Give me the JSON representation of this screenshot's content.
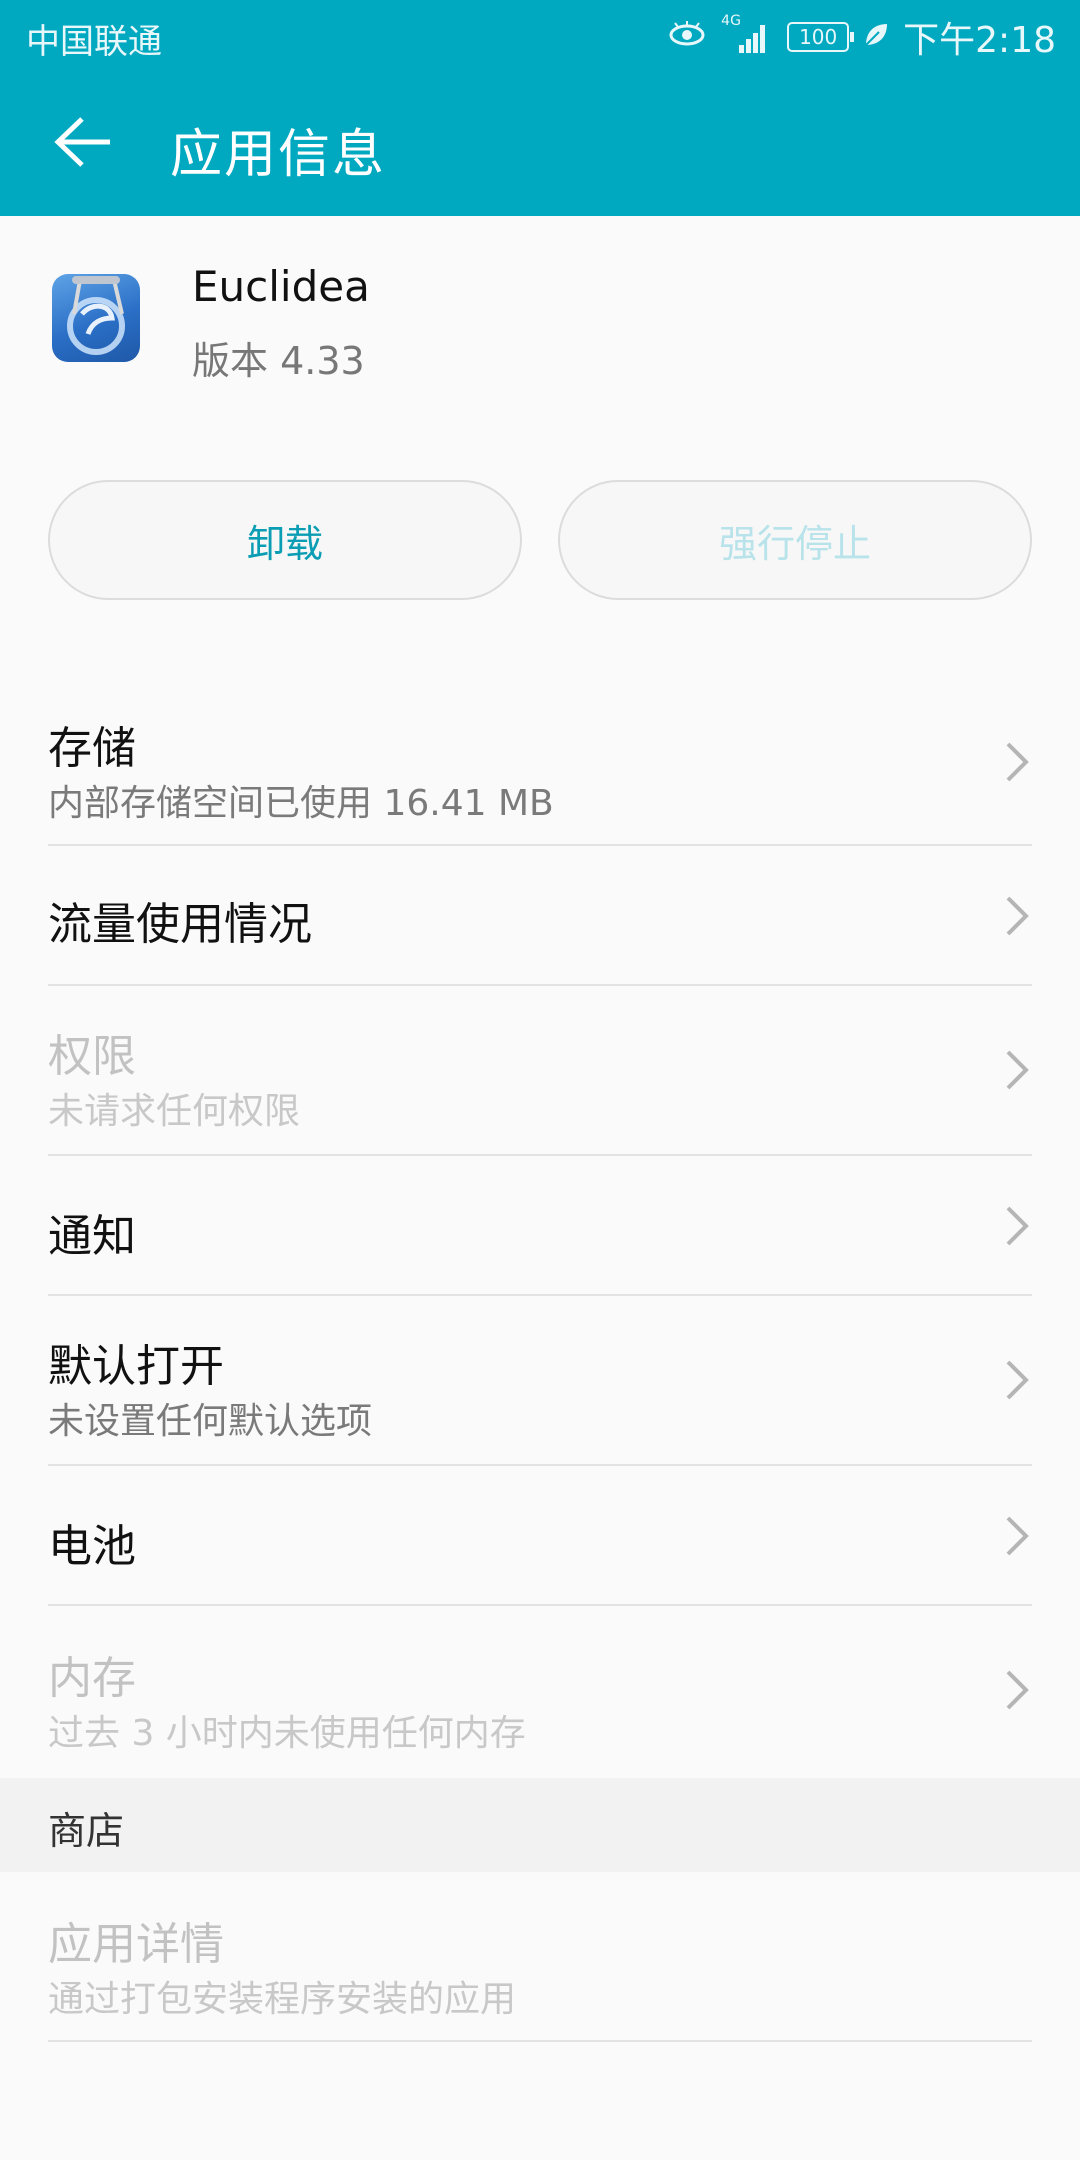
{
  "status_bar": {
    "carrier": "中国联通",
    "network": "4G",
    "battery": "100",
    "time": "下午2:18"
  },
  "app_bar": {
    "title": "应用信息",
    "back_icon": "arrow-left-icon"
  },
  "app": {
    "name": "Euclidea",
    "version": "版本 4.33",
    "icon": "euclidea-app-icon"
  },
  "buttons": {
    "uninstall": "卸载",
    "force_stop": "强行停止"
  },
  "settings": [
    {
      "title": "存储",
      "subtitle": "内部存储空间已使用 16.41 MB",
      "enabled": true
    },
    {
      "title": "流量使用情况",
      "subtitle": "",
      "enabled": true
    },
    {
      "title": "权限",
      "subtitle": "未请求任何权限",
      "enabled": false
    },
    {
      "title": "通知",
      "subtitle": "",
      "enabled": true
    },
    {
      "title": "默认打开",
      "subtitle": "未设置任何默认选项",
      "enabled": true
    },
    {
      "title": "电池",
      "subtitle": "",
      "enabled": true
    },
    {
      "title": "内存",
      "subtitle": "过去 3 小时内未使用任何内存",
      "enabled": false
    }
  ],
  "store": {
    "header": "商店",
    "item_title": "应用详情",
    "item_subtitle": "通过打包安装程序安装的应用"
  },
  "colors": {
    "accent": "#00a9c0",
    "button_text": "#0a9db3"
  }
}
